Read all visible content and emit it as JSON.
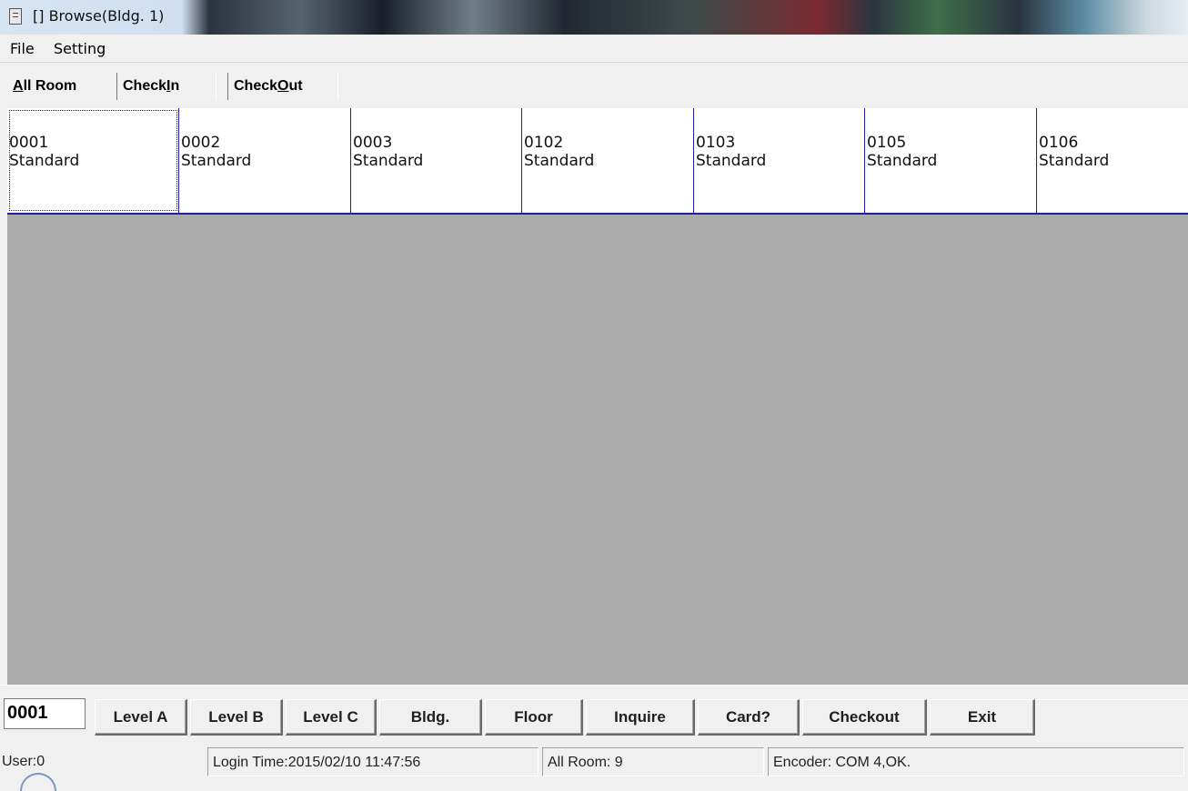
{
  "window": {
    "title": "[] Browse(Bldg. 1)",
    "icon": "document-window-icon"
  },
  "menu": {
    "file": "File",
    "setting": "Setting"
  },
  "tabs": {
    "all_room": {
      "prefix": "",
      "accel": "A",
      "suffix": "ll Room"
    },
    "checkin": {
      "prefix": "Check",
      "accel": "I",
      "suffix": "n"
    },
    "checkout": {
      "prefix": "Check",
      "accel": "O",
      "suffix": "ut"
    }
  },
  "rooms": [
    {
      "number": "0001",
      "type": "Standard",
      "selected": true
    },
    {
      "number": "0002",
      "type": "Standard"
    },
    {
      "number": "0003",
      "type": "Standard"
    },
    {
      "number": "0102",
      "type": "Standard"
    },
    {
      "number": "0103",
      "type": "Standard"
    },
    {
      "number": "0105",
      "type": "Standard"
    },
    {
      "number": "0106",
      "type": "Standard"
    }
  ],
  "toolbar": {
    "room_value": "0001",
    "level_a": "Level A",
    "level_b": "Level B",
    "level_c": "Level C",
    "bldg": "Bldg.",
    "floor": "Floor",
    "inquire": "Inquire",
    "card": "Card?",
    "checkout": "Checkout",
    "exit": "Exit"
  },
  "status": {
    "user": "User:0",
    "login_time": "Login Time:2015/02/10 11:47:56",
    "all_room": "All Room: 9",
    "encoder": "Encoder: COM 4,OK."
  },
  "colors": {
    "tile_border": "#1e1e9e",
    "grid_background": "#ababab",
    "window_bg": "#f0f0f0"
  }
}
